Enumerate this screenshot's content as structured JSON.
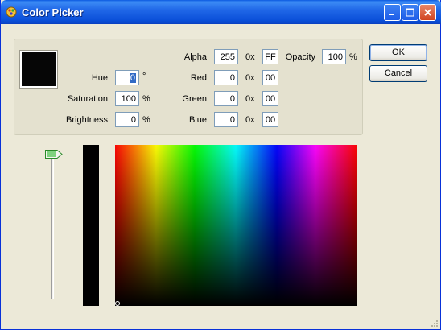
{
  "window": {
    "title": "Color Picker"
  },
  "titlebar_buttons": {
    "minimize": "minimize-icon",
    "maximize": "maximize-icon",
    "close": "close-icon"
  },
  "current_color": "#060606",
  "hsb": {
    "hue": {
      "label": "Hue",
      "value": "0",
      "unit": "°"
    },
    "saturation": {
      "label": "Saturation",
      "value": "100",
      "unit": "%"
    },
    "brightness": {
      "label": "Brightness",
      "value": "0",
      "unit": "%"
    }
  },
  "argb": {
    "alpha": {
      "label": "Alpha",
      "value": "255",
      "prefix": "0x",
      "hex": "FF"
    },
    "red": {
      "label": "Red",
      "value": "0",
      "prefix": "0x",
      "hex": "00"
    },
    "green": {
      "label": "Green",
      "value": "0",
      "prefix": "0x",
      "hex": "00"
    },
    "blue": {
      "label": "Blue",
      "value": "0",
      "prefix": "0x",
      "hex": "00"
    }
  },
  "opacity": {
    "label": "Opacity",
    "value": "100",
    "unit": "%"
  },
  "buttons": {
    "ok": "OK",
    "cancel": "Cancel"
  },
  "colors": {
    "title_bar": "#0a4fd8",
    "dialog_bg": "#ece9d8",
    "selection": "#316ac5"
  }
}
